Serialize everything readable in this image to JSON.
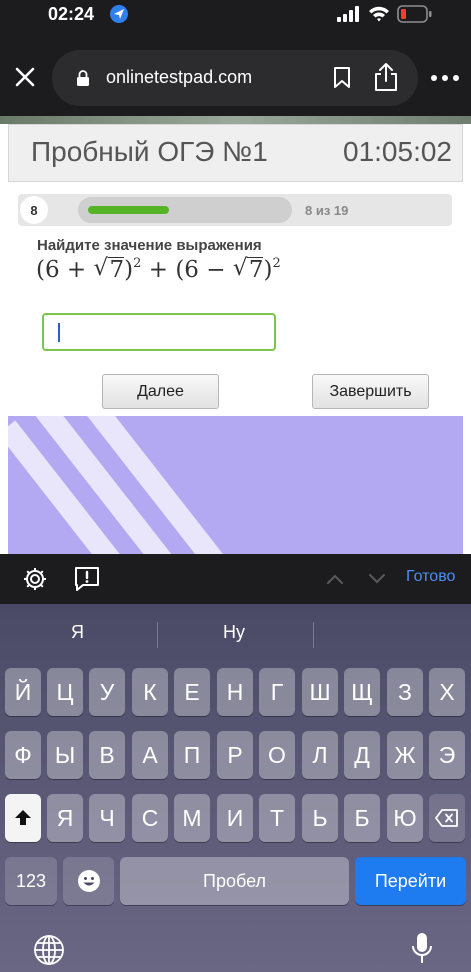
{
  "status": {
    "time": "02:24"
  },
  "browser": {
    "url": "onlinetestpad.com"
  },
  "test": {
    "title": "Пробный ОГЭ №1",
    "timer": "01:05:02",
    "question_number": "8",
    "progress_text": "8 из 19",
    "progress_fraction": 0.42,
    "question_label": "Найдите значение выражения",
    "expression": {
      "open1": "(6 +",
      "radicand1": "7",
      "close1": ")",
      "exp1": "2",
      "mid": "+ (6 −",
      "radicand2": "7",
      "close2": ")",
      "exp2": "2"
    },
    "answer_value": "",
    "next_label": "Далее",
    "finish_label": "Завершить"
  },
  "keyboard_toolbar": {
    "done_label": "Готово"
  },
  "keyboard": {
    "suggestions": [
      "Я",
      "Ну",
      ""
    ],
    "row1": [
      "Й",
      "Ц",
      "У",
      "К",
      "Е",
      "Н",
      "Г",
      "Ш",
      "Щ",
      "З",
      "Х"
    ],
    "row2": [
      "Ф",
      "Ы",
      "В",
      "А",
      "П",
      "Р",
      "О",
      "Л",
      "Д",
      "Ж",
      "Э"
    ],
    "row3": [
      "Я",
      "Ч",
      "С",
      "М",
      "И",
      "Т",
      "Ь",
      "Б",
      "Ю"
    ],
    "numbers_label": "123",
    "space_label": "Пробел",
    "go_label": "Перейти"
  }
}
